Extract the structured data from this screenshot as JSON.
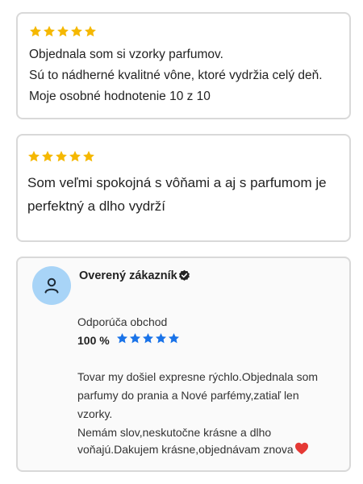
{
  "colors": {
    "star_gold": "#f5b800",
    "star_blue": "#1a73e8",
    "avatar_bg": "#a8d4f7",
    "heart": "#e53935"
  },
  "reviews": [
    {
      "rating": 5,
      "lines": [
        "Objednala som si vzorky parfumov.",
        "Sú to nádherné kvalitné vône, ktoré vydržia celý deň.",
        "Moje osobné hodnotenie 10 z 10"
      ]
    },
    {
      "rating": 5,
      "lines": [
        "Som veľmi spokojná s vôňami a aj s parfumom je",
        "perfektný a dlho vydrží"
      ]
    }
  ],
  "verified_review": {
    "author": "Overený zákazník",
    "avatar_icon": "user-icon",
    "verified_icon": "check-badge-icon",
    "recommend_label": "Odporúča obchod",
    "recommend_percent": "100 %",
    "rating": 5,
    "lines": [
      "Tovar my došiel expresne rýchlo.Objednala som",
      "parfumy do prania a Nové parfémy,zatiaľ len",
      "vzorky.",
      "Nemám slov,neskutočne krásne a dlho",
      "voňajú.Dakujem krásne,objednávam znova"
    ],
    "end_icon": "heart-icon"
  }
}
